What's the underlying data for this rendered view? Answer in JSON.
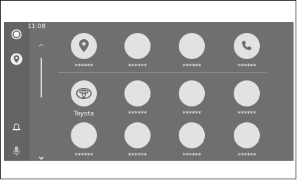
{
  "status": {
    "time": "11:08"
  },
  "rail": [
    {
      "icon": "record-icon"
    },
    {
      "icon": "maps-pin-icon"
    },
    {
      "icon": "bell-icon"
    },
    {
      "icon": "microphone-icon"
    }
  ],
  "apps": [
    {
      "label": "******",
      "icon": "maps-pin-icon"
    },
    {
      "label": "******",
      "icon": ""
    },
    {
      "label": "******",
      "icon": ""
    },
    {
      "label": "******",
      "icon": "phone-icon"
    },
    {
      "label": "Toyota",
      "icon": "toyota-logo-icon"
    },
    {
      "label": "******",
      "icon": ""
    },
    {
      "label": "******",
      "icon": ""
    },
    {
      "label": "******",
      "icon": ""
    },
    {
      "label": "******",
      "icon": ""
    },
    {
      "label": "******",
      "icon": ""
    },
    {
      "label": "******",
      "icon": ""
    },
    {
      "label": "******",
      "icon": ""
    }
  ]
}
